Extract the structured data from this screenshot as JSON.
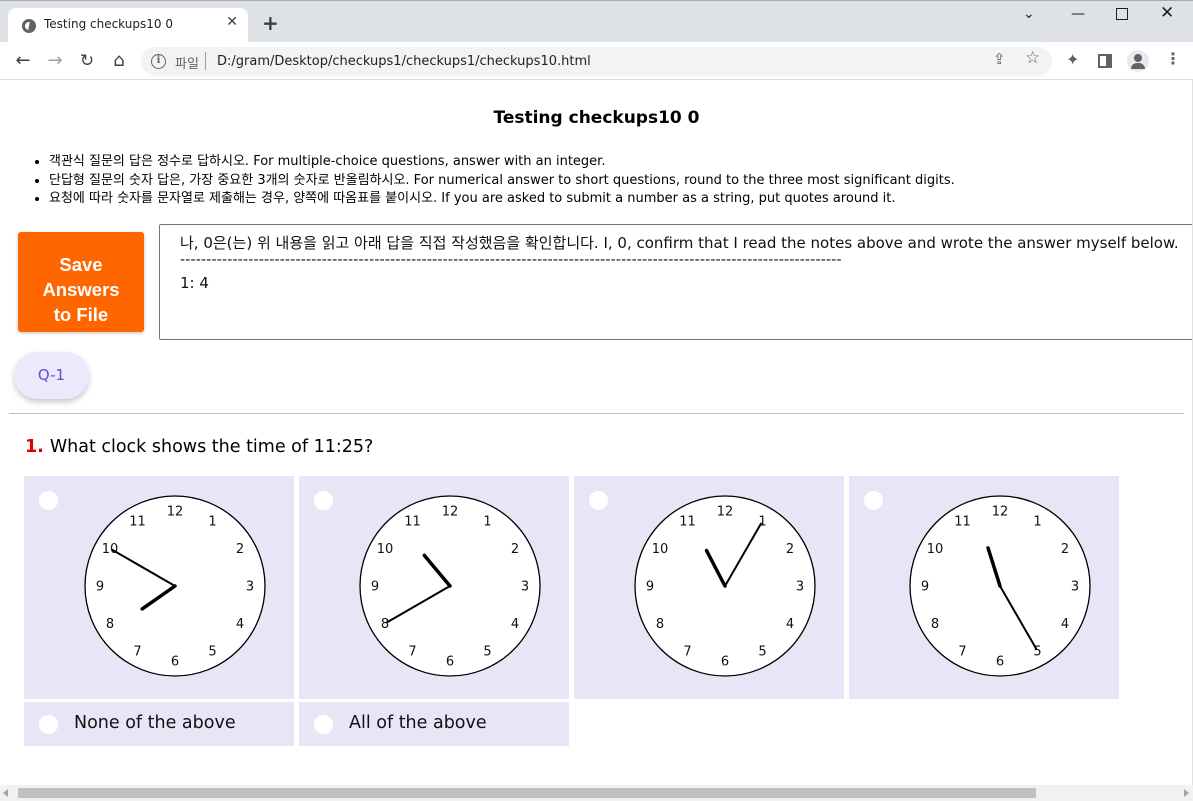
{
  "browser": {
    "tab_title": "Testing checkups10 0",
    "url_scheme_label": "파일",
    "url": "D:/gram/Desktop/checkups1/checkups1/checkups10.html"
  },
  "page": {
    "title": "Testing checkups10 0",
    "instructions": [
      "객관식 질문의 답은 정수로 답하시오. For multiple-choice questions, answer with an integer.",
      "단답형 질문의 숫자 답은, 가장 중요한 3개의 숫자로 반올림하시오. For numerical answer to short questions, round to the three most significant digits.",
      "요청에 따라 숫자를 문자열로 제출해는 경우, 양쪽에 따옴표를 붙이시오. If you are asked to submit a number as a string, put quotes around it."
    ],
    "save_button": [
      "Save",
      "Answers",
      "to File"
    ],
    "answer_box": {
      "line1": "나, 0은(는) 위 내용을 읽고 아래 답을 직접 작성했음을 확인합니다. I, 0, confirm that I read the notes above and wrote the answer myself below.",
      "line2": "------------------------------------------------------------------------------------------------------------------------------",
      "line3": "1: 4"
    },
    "question_nav": [
      "Q-1"
    ]
  },
  "question": {
    "number": "1.",
    "text": "What clock shows the time of 11:25?",
    "clock_numbers": [
      "12",
      "1",
      "2",
      "3",
      "4",
      "5",
      "6",
      "7",
      "8",
      "9",
      "10",
      "11"
    ],
    "clock_options": [
      {
        "time": "7:50"
      },
      {
        "time": "10:40"
      },
      {
        "time": "11:05"
      },
      {
        "time": "11:25"
      }
    ],
    "text_options": [
      "None of the above",
      "All of the above"
    ]
  }
}
